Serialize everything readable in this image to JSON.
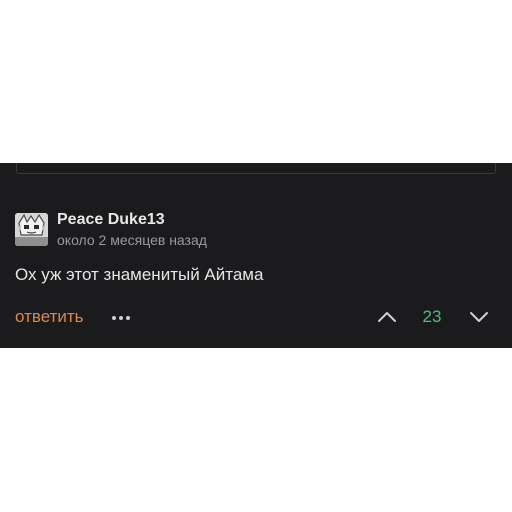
{
  "comment": {
    "author": "Peace Duke13",
    "timestamp": "около 2 месяцев назад",
    "text": "Ох уж этот знаменитый Айтама",
    "avatar_icon": "anime-character-avatar"
  },
  "actions": {
    "reply_label": "ответить",
    "more_icon": "more-dots-icon",
    "upvote_icon": "chevron-up-icon",
    "downvote_icon": "chevron-down-icon",
    "vote_count": "23"
  },
  "colors": {
    "background": "#1b1b1d",
    "reply_accent": "#e2844f",
    "vote_positive": "#4fbf76",
    "secondary_text": "#9a9a9e"
  }
}
